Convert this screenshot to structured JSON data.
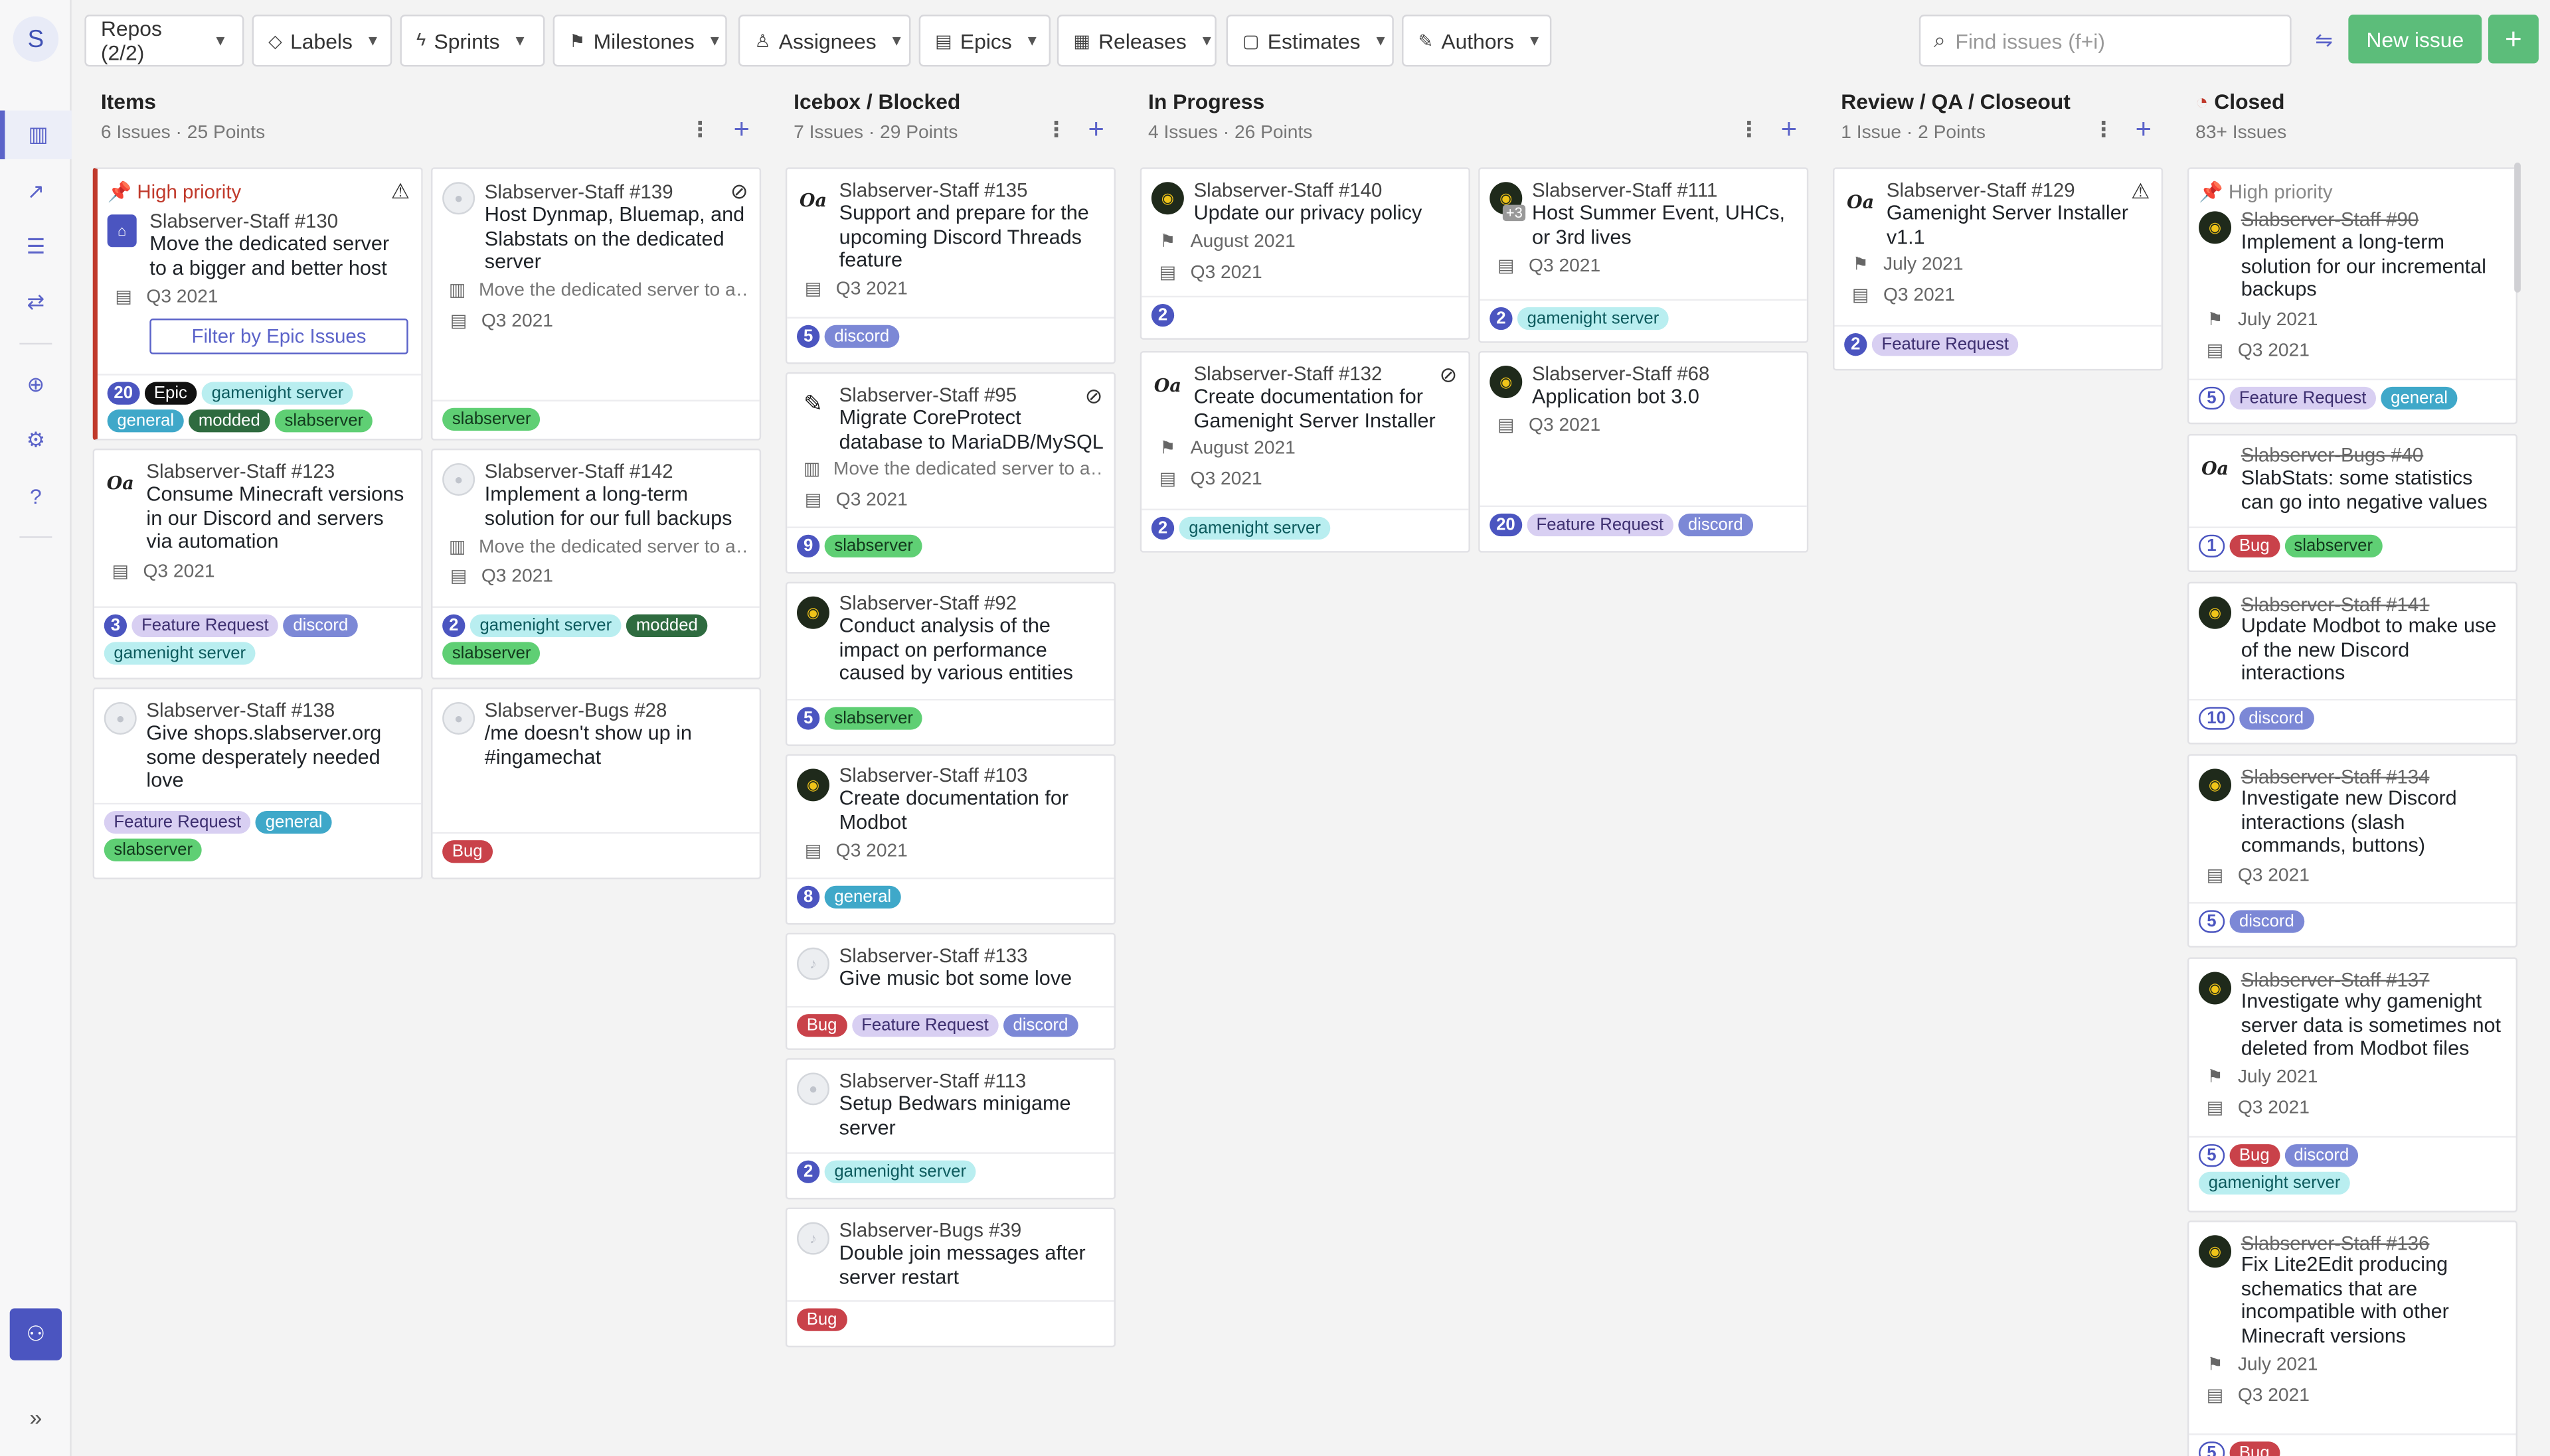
{
  "topbar": {
    "filters": [
      "Repos (2/2)",
      "Labels",
      "Sprints",
      "Milestones",
      "Assignees",
      "Epics",
      "Releases",
      "Estimates",
      "Authors"
    ],
    "search_placeholder": "Find issues (f+i)",
    "new_issue": "New issue",
    "plus": "+"
  },
  "rail": {
    "workspace_initial": "S"
  },
  "colors": {
    "accent": "#4b55c0",
    "new_issue": "#5cbd7a",
    "high_priority": "#c0392b"
  },
  "columns": [
    {
      "title": "Items",
      "count": "6 Issues",
      "points": "25 Points"
    },
    {
      "title": "Icebox / Blocked",
      "count": "7 Issues",
      "points": "29 Points"
    },
    {
      "title": "In Progress",
      "count": "4 Issues",
      "points": "26 Points"
    },
    {
      "title": "Review / QA / Closeout",
      "count": "1 Issue",
      "points": "2 Points"
    },
    {
      "title": "Closed",
      "count": "83+ Issues",
      "points": ""
    }
  ],
  "labels": {
    "gamenight": "gamenight server",
    "general": "general",
    "modded": "modded",
    "slabserver": "slabserver",
    "feature": "Feature Request",
    "discord": "discord",
    "bug": "Bug",
    "epic": "Epic"
  },
  "common": {
    "high_priority": "High priority",
    "filter_epic": "Filter by Epic Issues",
    "q3": "Q3 2021",
    "august": "August 2021",
    "july": "July 2021",
    "move_server": "Move the dedicated server to a…"
  },
  "items": {
    "c130": {
      "repo": "Slabserver-Staff",
      "num": "#130",
      "title": "Move the dedicated server to a bigger and better host",
      "est": "20"
    },
    "c139": {
      "repo": "Slabserver-Staff",
      "num": "#139",
      "title": "Host Dynmap, Bluemap, and Slabstats on the dedicated server"
    },
    "c123": {
      "repo": "Slabserver-Staff",
      "num": "#123",
      "title": "Consume Minecraft versions in our Discord and servers via automation",
      "est": "3"
    },
    "c142": {
      "repo": "Slabserver-Staff",
      "num": "#142",
      "title": "Implement a long-term solution for our full backups",
      "est": "2"
    },
    "c138": {
      "repo": "Slabserver-Staff",
      "num": "#138",
      "title": "Give shops.slabserver.org some desperately needed love"
    },
    "c28": {
      "repo": "Slabserver-Bugs",
      "num": "#28",
      "title": "/me doesn't show up in #ingamechat"
    }
  },
  "icebox": {
    "c135": {
      "repo": "Slabserver-Staff",
      "num": "#135",
      "title": "Support and prepare for the upcoming Discord Threads feature",
      "est": "5"
    },
    "c95": {
      "repo": "Slabserver-Staff",
      "num": "#95",
      "title": "Migrate CoreProtect database to MariaDB/MySQL",
      "est": "9"
    },
    "c92": {
      "repo": "Slabserver-Staff",
      "num": "#92",
      "title": "Conduct analysis of the impact on performance caused by various entities",
      "est": "5"
    },
    "c103": {
      "repo": "Slabserver-Staff",
      "num": "#103",
      "title": "Create documentation for Modbot",
      "est": "8"
    },
    "c133": {
      "repo": "Slabserver-Staff",
      "num": "#133",
      "title": "Give music bot some love"
    },
    "c113": {
      "repo": "Slabserver-Staff",
      "num": "#113",
      "title": "Setup Bedwars minigame server",
      "est": "2"
    },
    "c39": {
      "repo": "Slabserver-Bugs",
      "num": "#39",
      "title": "Double join messages after server restart"
    }
  },
  "progress": {
    "c140": {
      "repo": "Slabserver-Staff",
      "num": "#140",
      "title": "Update our privacy policy",
      "est": "2"
    },
    "c111": {
      "repo": "Slabserver-Staff",
      "num": "#111",
      "title": "Host Summer Event, UHCs, or 3rd lives",
      "est": "2",
      "extra": "+3"
    },
    "c132": {
      "repo": "Slabserver-Staff",
      "num": "#132",
      "title": "Create documentation for Gamenight Server Installer",
      "est": "2"
    },
    "c68": {
      "repo": "Slabserver-Staff",
      "num": "#68",
      "title": "Application bot 3.0",
      "est": "20"
    }
  },
  "review": {
    "c129": {
      "repo": "Slabserver-Staff",
      "num": "#129",
      "title": "Gamenight Server Installer v1.1",
      "est": "2"
    }
  },
  "closed": {
    "c90": {
      "repo": "Slabserver-Staff",
      "num": "#90",
      "title": "Implement a long-term solution for our incremental backups",
      "est": "5"
    },
    "c40": {
      "repo": "Slabserver-Bugs",
      "num": "#40",
      "title": "SlabStats: some statistics can go into negative values",
      "est": "1"
    },
    "c141": {
      "repo": "Slabserver-Staff",
      "num": "#141",
      "title": "Update Modbot to make use of the new Discord interactions",
      "est": "10"
    },
    "c134": {
      "repo": "Slabserver-Staff",
      "num": "#134",
      "title": "Investigate new Discord interactions (slash commands, buttons)",
      "est": "5"
    },
    "c137": {
      "repo": "Slabserver-Staff",
      "num": "#137",
      "title": "Investigate why gamenight server data is sometimes not deleted from Modbot files",
      "est": "5"
    },
    "c136": {
      "repo": "Slabserver-Staff",
      "num": "#136",
      "title": "Fix Lite2Edit producing schematics that are incompatible with other Minecraft versions",
      "est": "5"
    }
  }
}
